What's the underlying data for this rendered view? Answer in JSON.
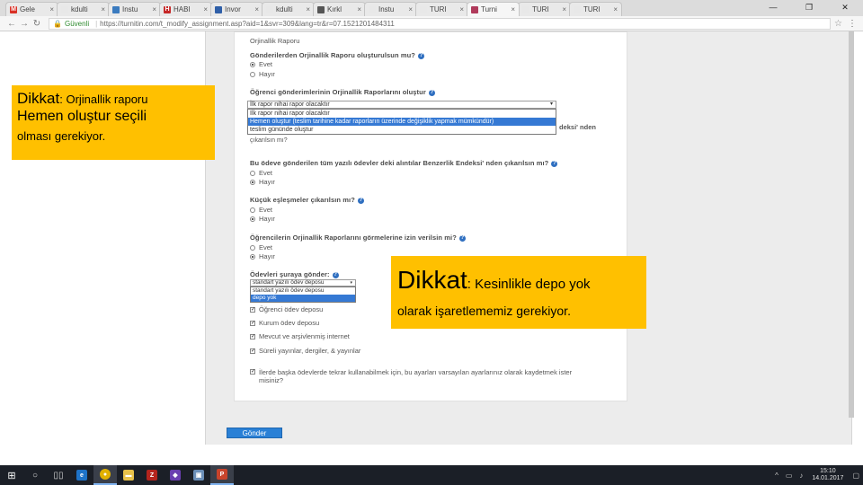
{
  "browser": {
    "tabs": [
      {
        "label": "Gele",
        "favicon_color": "#d93025",
        "favicon_glyph": "M",
        "active": false
      },
      {
        "label": "kdulti",
        "favicon_color": "#e8e8e8",
        "favicon_glyph": "",
        "active": false
      },
      {
        "label": "Instu",
        "favicon_color": "#3b7bbf",
        "favicon_glyph": "",
        "active": false
      },
      {
        "label": "HABI",
        "favicon_color": "#c62828",
        "favicon_glyph": "H",
        "active": false
      },
      {
        "label": "Invor",
        "favicon_color": "#2f5fa8",
        "favicon_glyph": "",
        "active": false
      },
      {
        "label": "kdulti",
        "favicon_color": "#e8e8e8",
        "favicon_glyph": "",
        "active": false
      },
      {
        "label": "Kırkl",
        "favicon_color": "#555555",
        "favicon_glyph": "",
        "active": false
      },
      {
        "label": "Instu",
        "favicon_color": "#e8e8e8",
        "favicon_glyph": "",
        "active": false
      },
      {
        "label": "TURI",
        "favicon_color": "#e8e8e8",
        "favicon_glyph": "",
        "active": false
      },
      {
        "label": "Turni",
        "favicon_color": "#b03a5b",
        "favicon_glyph": "",
        "active": true
      },
      {
        "label": "TURI",
        "favicon_color": "#e8e8e8",
        "favicon_glyph": "",
        "active": false
      },
      {
        "label": "TURI",
        "favicon_color": "#e8e8e8",
        "favicon_glyph": "",
        "active": false
      }
    ],
    "tab_close": "×",
    "window_controls": [
      "—",
      "❐",
      "✕"
    ],
    "secure_label": "Güvenli",
    "url": "https://turnitin.com/t_modify_assignment.asp?aid=1&svr=309&lang=tr&r=07.1521201484311"
  },
  "form": {
    "section_title": "Orjinallik Raporu",
    "q1": {
      "label": "Gönderilerden Orjinallik Raporu oluşturulsun mu?",
      "options": [
        "Evet",
        "Hayır"
      ],
      "selected": 0
    },
    "q2": {
      "label": "Öğrenci gönderimlerinin Orjinallik Raporlarını oluştur",
      "selected_value": "İlk rapor nihai rapor olacaktır",
      "options": [
        "İlk rapor nihai rapor olacaktır",
        "Hemen oluştur (teslim tarihine kadar raporların üzerinde değişiklik yapmak mümkündür)",
        "teslim gününde oluştur"
      ],
      "highlighted": 1,
      "behind_text": "deksi' nden",
      "behind_text2": "çıkarılsın mı?"
    },
    "q3": {
      "label": "Bu ödeve gönderilen tüm yazılı ödevler deki alıntılar Benzerlik Endeksi' nden çıkarılsın mı?",
      "options": [
        "Evet",
        "Hayır"
      ],
      "selected": 1
    },
    "q4": {
      "label": "Küçük eşleşmeler çıkarılsın mı?",
      "options": [
        "Evet",
        "Hayır"
      ],
      "selected": 1
    },
    "q5": {
      "label": "Öğrencilerin Orjinallik Raporlarını görmelerine izin verilsin mi?",
      "options": [
        "Evet",
        "Hayır"
      ],
      "selected": 1
    },
    "q6": {
      "label": "Ödevleri şuraya gönder:",
      "selected_value": "standart yazılı ödev deposu",
      "options": [
        "standart yazılı ödev deposu",
        "depo yok"
      ],
      "highlighted": 1
    },
    "checkboxes": [
      {
        "label": "Öğrenci ödev deposu",
        "checked": true
      },
      {
        "label": "Kurum ödev deposu",
        "checked": true
      },
      {
        "label": "Mevcut ve arşivlenmiş internet",
        "checked": true
      },
      {
        "label": "Süreli yayınlar, dergiler, & yayınlar",
        "checked": true
      },
      {
        "label": "İlerde başka ödevlerde tekrar kullanabilmek için, bu ayarları varsayılan ayarlarınız olarak kaydetmek ister misiniz?",
        "checked": true
      }
    ],
    "submit_label": "Gönder"
  },
  "notes": {
    "note1": {
      "title_big": "Dikkat",
      "title_rest": ": Orjinallik raporu",
      "line2": "Hemen oluştur seçili",
      "line3": "olması gerekiyor."
    },
    "note2": {
      "title_big": "Dikkat",
      "title_rest": ": Kesinlikle depo yok",
      "line2": "olarak işaretlememiz gerekiyor."
    }
  },
  "taskbar": {
    "apps": [
      "windows-start",
      "search",
      "task-view",
      "edge",
      "chrome",
      "file-explorer",
      "filezilla",
      "visual-studio",
      "box",
      "powerpoint"
    ],
    "time": "15:10",
    "date": "14.01.2017"
  },
  "colors": {
    "note_bg": "#ffc000",
    "submit_bg": "#2a80d6",
    "highlight": "#3579d4"
  }
}
